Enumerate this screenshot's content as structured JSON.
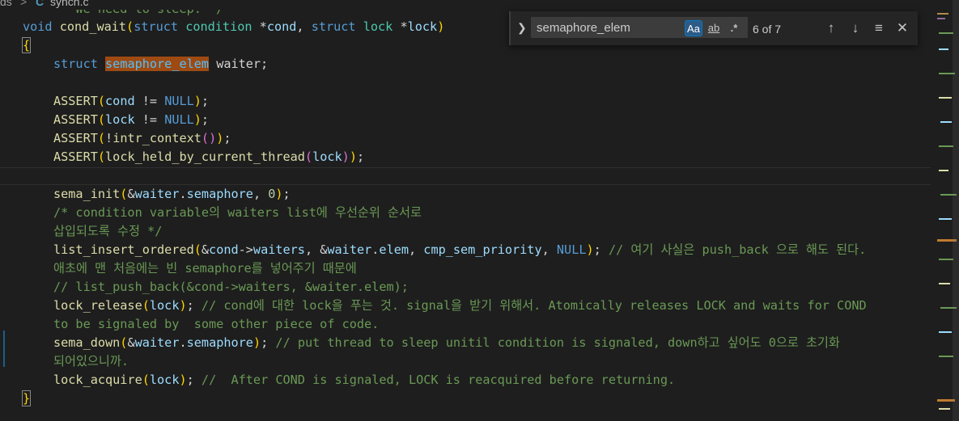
{
  "tab": {
    "breadcrumb_partial": "ds",
    "separator": ">",
    "file_icon": "C",
    "filename": "synch.c"
  },
  "ghost_comment": "   We need to sleep. */",
  "code": {
    "l1": {
      "kw": "void",
      "fn": "cond_wait",
      "p1kw": "struct",
      "p1ty": "condition",
      "p1star": "*",
      "p1var": "cond",
      "p2kw": "struct",
      "p2ty": "lock",
      "p2star": "*",
      "p2var": "lock"
    },
    "l2": "{",
    "l3": {
      "kw": "struct",
      "match": "semaphore_elem",
      "rest": " waiter;"
    },
    "l5": {
      "fn": "ASSERT",
      "var": "cond",
      "op": " != ",
      "kw": "NULL",
      "end": ";"
    },
    "l6": {
      "fn": "ASSERT",
      "var": "lock",
      "op": " != ",
      "kw": "NULL",
      "end": ";"
    },
    "l7": {
      "fn": "ASSERT",
      "pre": "!",
      "fn2": "intr_context",
      "end": ";"
    },
    "l8": {
      "fn": "ASSERT",
      "fn2": "lock_held_by_current_thread",
      "var": "lock",
      "end": ";"
    },
    "l10": {
      "fn": "sema_init",
      "amp": "&",
      "var1": "waiter",
      "dot": ".",
      "var2": "semaphore",
      "comma": ", ",
      "num": "0",
      "end": ";"
    },
    "l11": "/* condition variable의 waiters list에 우선순위 순서로",
    "l12": "삽입되도록 수정 */",
    "l13": {
      "fn": "list_insert_ordered",
      "amp1": "&",
      "v1": "cond",
      "arrow": "->",
      "v2": "waiters",
      "c1": ", ",
      "amp2": "&",
      "v3": "waiter",
      "dot": ".",
      "v4": "elem",
      "c2": ", ",
      "v5": "cmp_sem_priority",
      "c3": ", ",
      "kw": "NULL",
      "end": ";",
      "cm": " // 여기 사실은 push_back 으로 해도 된다."
    },
    "l14": "애초에 맨 처음에는 빈 semaphore를 넣어주기 때문에",
    "l15": "// list_push_back(&cond->waiters, &waiter.elem);",
    "l16": {
      "fn": "lock_release",
      "var": "lock",
      "end": ";",
      "cm": " // cond에 대한 lock을 푸는 것. signal을 받기 위해서. Atomically releases LOCK and waits for COND"
    },
    "l17": "to be signaled by  some other piece of code.",
    "l18": {
      "fn": "sema_down",
      "amp": "&",
      "v1": "waiter",
      "dot": ".",
      "v2": "semaphore",
      "end": ";",
      "cm": " // put thread to sleep unitil condition is signaled, down하고 싶어도 0으로 초기화"
    },
    "l19": "되어있으니까.",
    "l20": {
      "fn": "lock_acquire",
      "var": "lock",
      "end": ";",
      "cm": " //  After COND is signaled, LOCK is reacquired before returning."
    },
    "l21": "}"
  },
  "find_widget": {
    "toggle_icon": "chevron-right",
    "query": "semaphore_elem",
    "match_case_label": "Aa",
    "whole_word_label": "ab",
    "regex_label": ".*",
    "count": "6 of 7",
    "prev_icon": "arrow-up",
    "next_icon": "arrow-down",
    "selection_icon": "list",
    "close_icon": "close"
  }
}
